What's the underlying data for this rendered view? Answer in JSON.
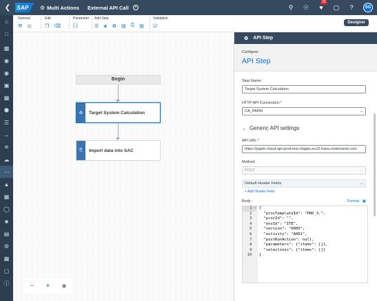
{
  "shell": {
    "logo": "SAP",
    "app_title": "Multi Actions",
    "doc_title": "External API Call",
    "notif_count": "33",
    "avatar": "SG"
  },
  "toolbar": {
    "groups": [
      "General",
      "Edit",
      "Parameter",
      "Add Step",
      "Validation"
    ],
    "designer": "Designer"
  },
  "canvas": {
    "begin": "Begin",
    "nodes": [
      "Target System Calculation",
      "Import data into SAC"
    ]
  },
  "panel": {
    "header": "API Step",
    "configure": "Configure",
    "title": "API Step",
    "step_name_label": "Step Name:",
    "step_name_value": "Target System Calculation",
    "conn_label": "HTTP API Connection:",
    "conn_value": "CA_PAPM",
    "section": "Generic API settings",
    "url_label": "API URL:",
    "url_value": "https://papm-cloud-api-prod-test.cfapps.eu10.hana.ondemand.com",
    "method_label": "Method:",
    "method_value": "POST",
    "header_fields": "Default Header Fields",
    "add_header": "+ Add Header Field",
    "body_label": "Body:",
    "format": "Format",
    "code_lines": [
      "{",
      "  \"procTemplateId\": \"PRO_3.\",",
      "  \"procId\": \"\",",
      "  \"envId\": \"ITE\",",
      "  \"version\": \"0005\",",
      "  \"activity\": \"A001\",",
      "  \"postRunAction\": null,",
      "  \"parameters\": {\"items\": []},",
      "  \"selections\": {\"items\": []}",
      "}"
    ]
  },
  "colors": {
    "shell": "#354a5f",
    "accent": "#0a6ed1",
    "nav": "#2c3e50"
  }
}
